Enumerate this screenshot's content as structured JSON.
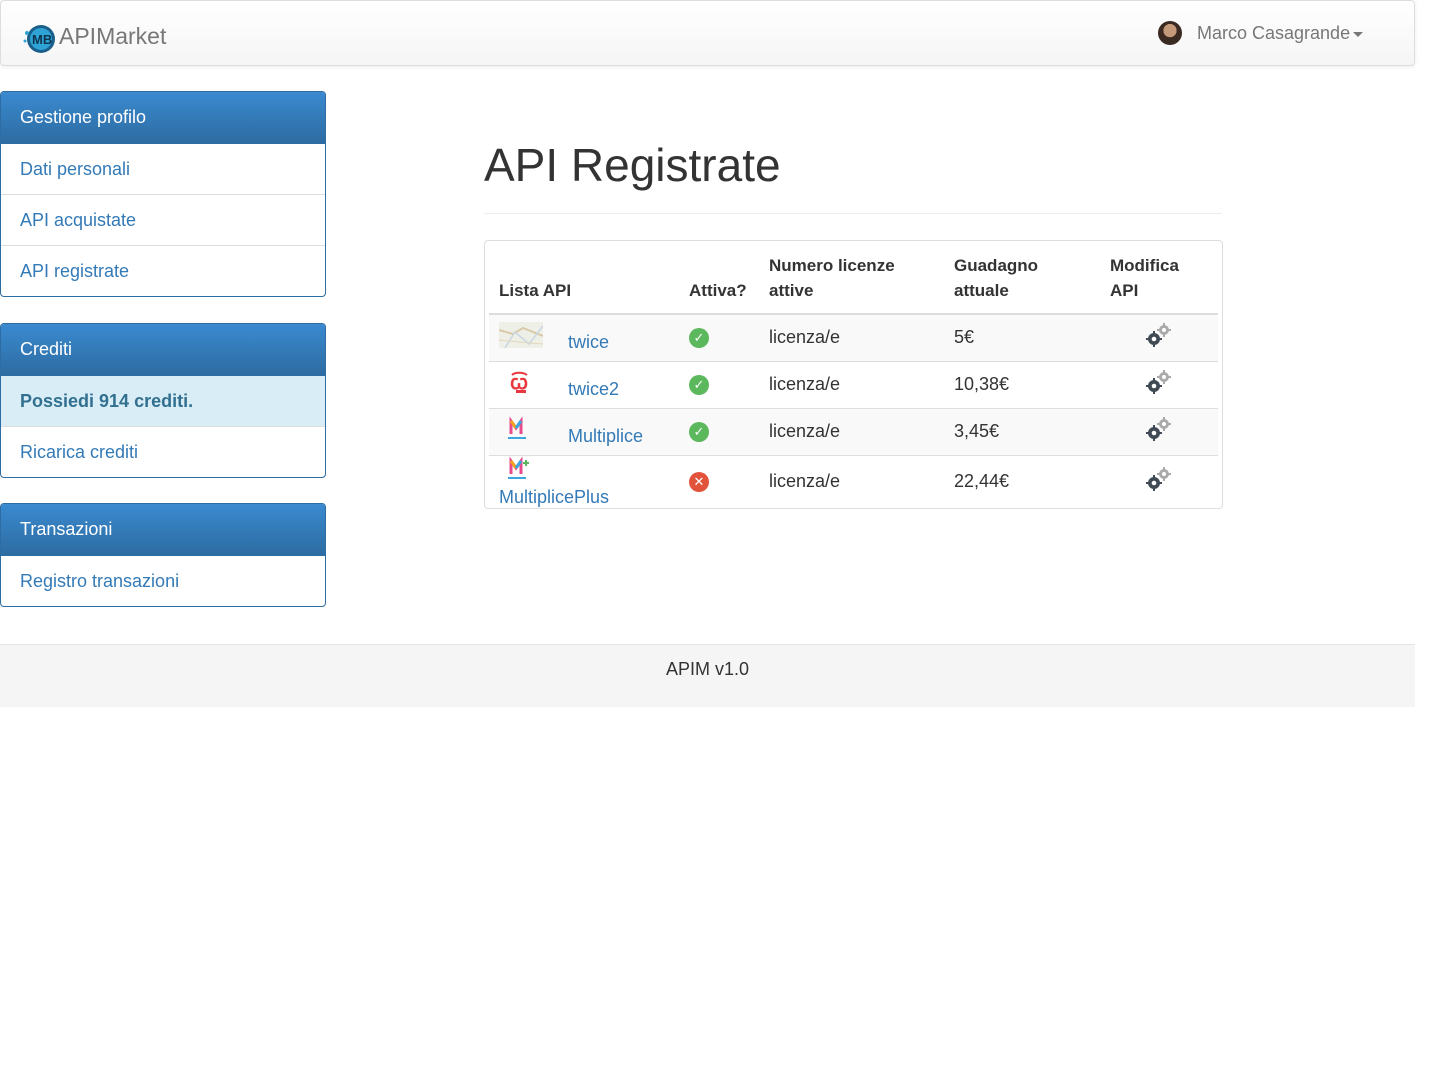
{
  "navbar": {
    "brand": "APIMarket",
    "user_name": "Marco Casagrande"
  },
  "sidebar": {
    "profile": {
      "heading": "Gestione profilo",
      "items": [
        {
          "label": "Dati personali"
        },
        {
          "label": "API acquistate"
        },
        {
          "label": "API registrate"
        }
      ]
    },
    "credits": {
      "heading": "Crediti",
      "balance_text": "Possiedi 914 crediti.",
      "recharge_label": "Ricarica crediti"
    },
    "transactions": {
      "heading": "Transazioni",
      "items": [
        {
          "label": "Registro transazioni"
        }
      ]
    }
  },
  "main": {
    "title": "API Registrate",
    "table": {
      "headers": {
        "list": "Lista API",
        "active": "Attiva?",
        "licenses_line1": "Numero licenze",
        "licenses_line2": "attive",
        "earnings_line1": "Guadagno",
        "earnings_line2": "attuale",
        "edit_line1": "Modifica",
        "edit_line2": "API"
      },
      "rows": [
        {
          "name": "twice",
          "active": true,
          "licenses": "licenza/e",
          "earnings": "5€",
          "logo": "map-thumbnail"
        },
        {
          "name": "twice2",
          "active": true,
          "licenses": "licenza/e",
          "earnings": "10,38€",
          "logo": "twice-logo"
        },
        {
          "name": "Multiplice",
          "active": true,
          "licenses": "licenza/e",
          "earnings": "3,45€",
          "logo": "multiplice-logo"
        },
        {
          "name": "MultiplicePlus",
          "active": false,
          "licenses": "licenza/e",
          "earnings": "22,44€",
          "logo": "multiplice-plus-logo"
        }
      ]
    }
  },
  "footer": {
    "text": "APIM v1.0"
  }
}
